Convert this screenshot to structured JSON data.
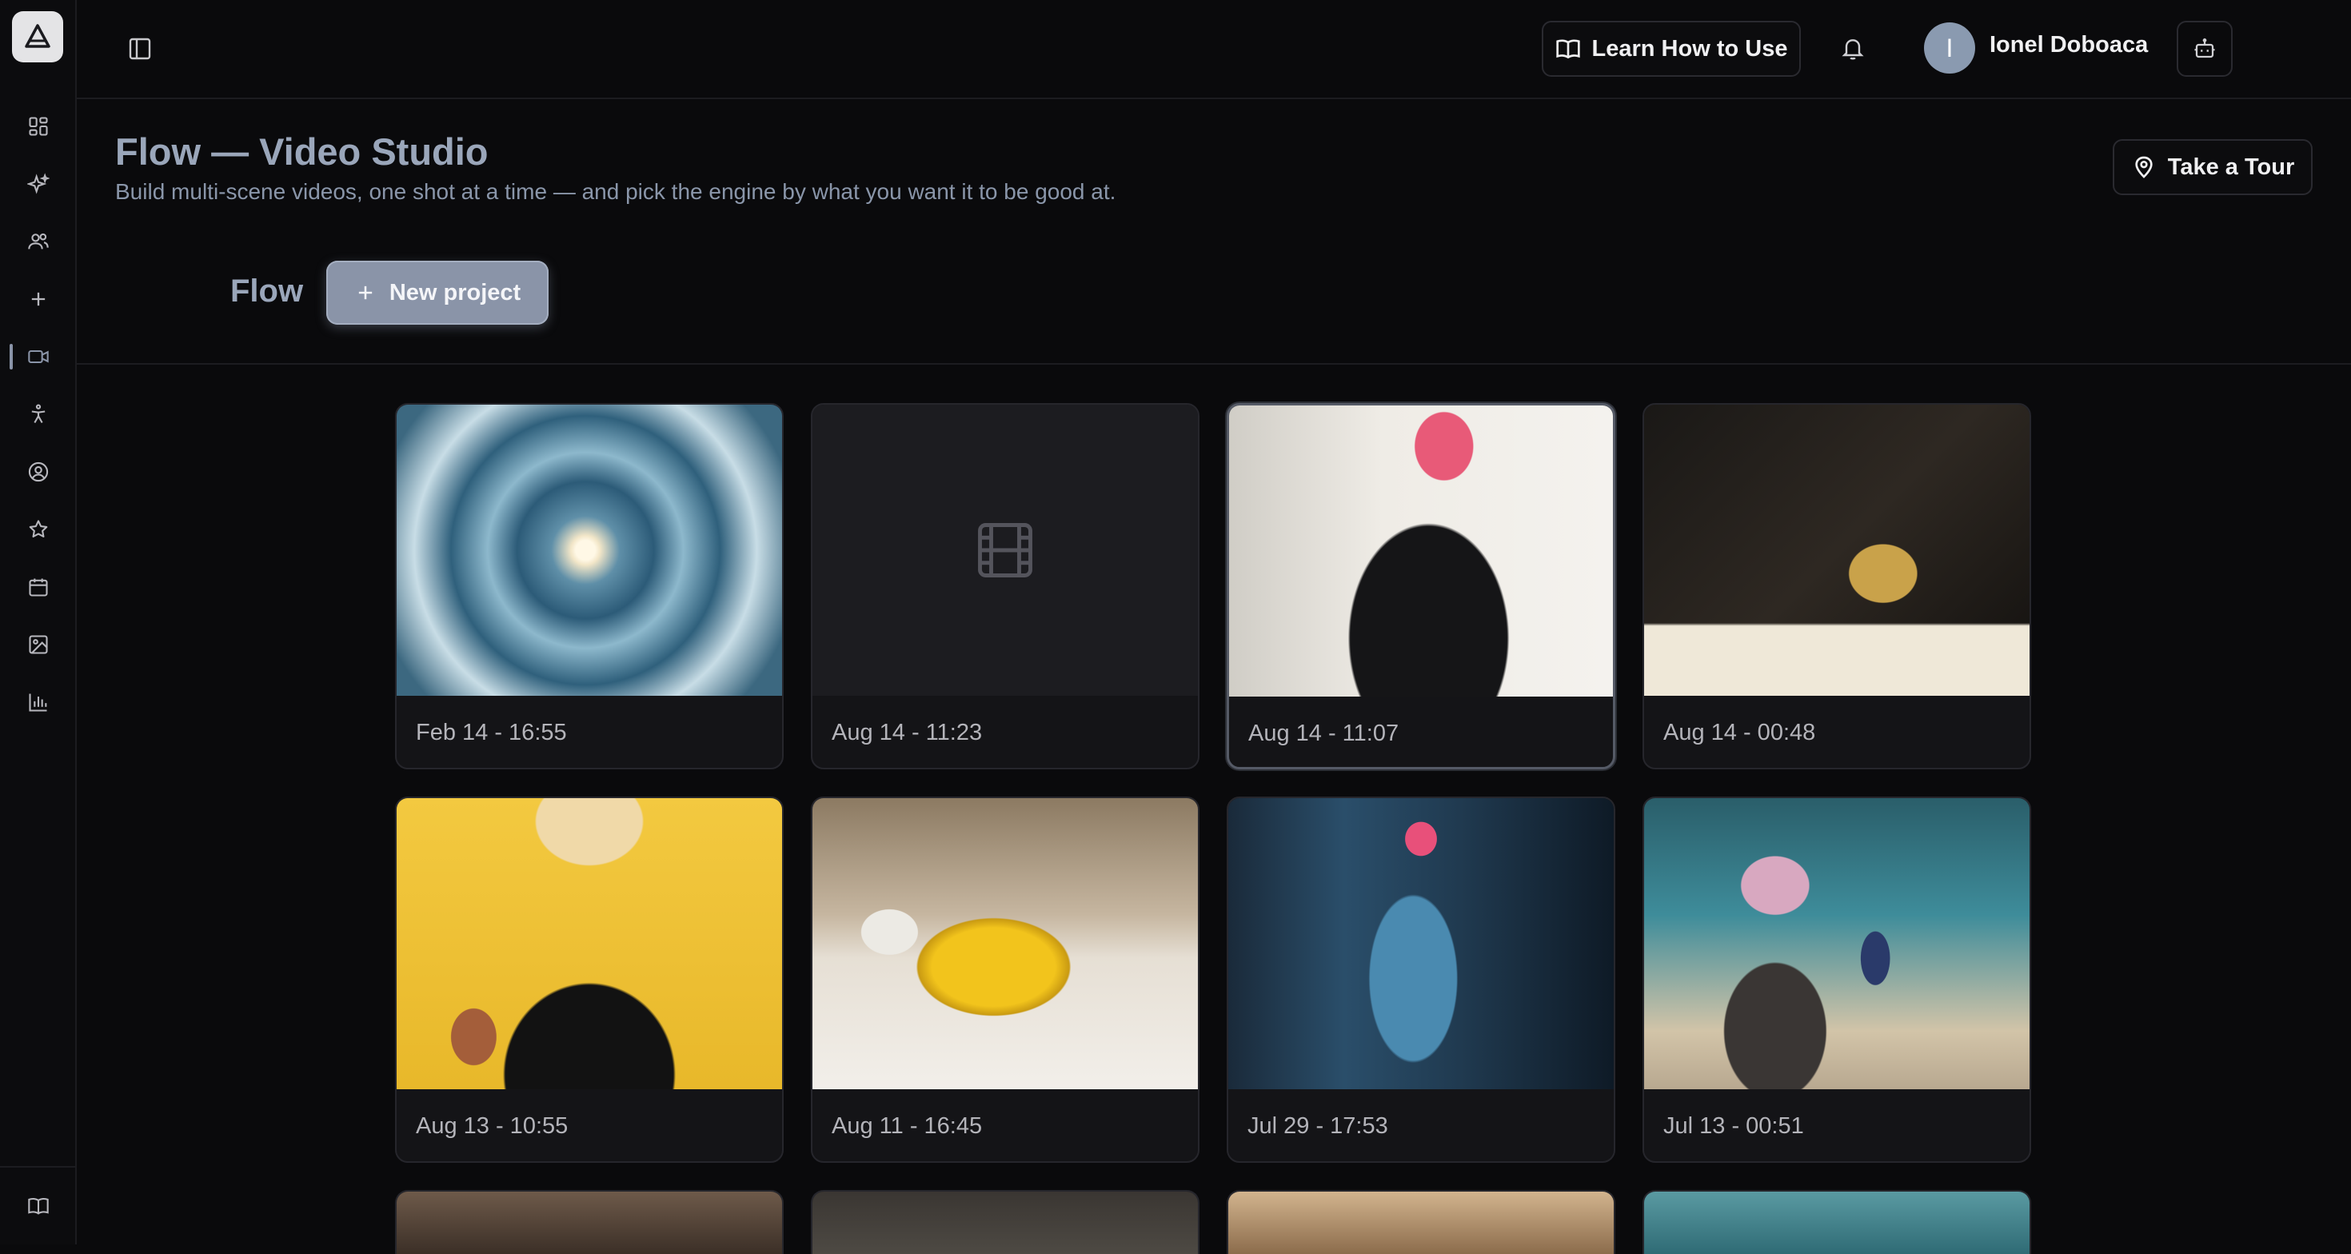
{
  "topbar": {
    "learn_label": "Learn How to Use",
    "avatar_initial": "I",
    "username": "Ionel Doboaca"
  },
  "page": {
    "title": "Flow — Video Studio",
    "subtitle": "Build multi-scene videos, one shot at a time — and pick the engine by what you want it to be good at.",
    "tour_label": "Take a Tour"
  },
  "toolbar": {
    "flow_label": "Flow",
    "new_project_label": "New project"
  },
  "sidebar": {
    "items": [
      {
        "icon": "dashboard-icon"
      },
      {
        "icon": "sparkle-icon"
      },
      {
        "icon": "users-icon"
      },
      {
        "icon": "plus-icon"
      },
      {
        "icon": "video-icon",
        "active": true
      },
      {
        "icon": "accessibility-icon"
      },
      {
        "icon": "user-circle-icon"
      },
      {
        "icon": "star-icon"
      },
      {
        "icon": "calendar-icon"
      },
      {
        "icon": "image-icon"
      },
      {
        "icon": "bar-chart-icon"
      }
    ],
    "bottom_icon": "book-icon"
  },
  "projects": [
    {
      "date": "Feb 14 - 16:55"
    },
    {
      "date": "Aug 14 - 11:23"
    },
    {
      "date": "Aug 14 - 11:07",
      "selected": true
    },
    {
      "date": "Aug 14 - 00:48"
    },
    {
      "date": "Aug 13 - 10:55"
    },
    {
      "date": "Aug 11 - 16:45"
    },
    {
      "date": "Jul 29 - 17:53"
    },
    {
      "date": "Jul 13 - 00:51"
    }
  ],
  "colors": {
    "accent": "#8a94a8",
    "title": "#9aa6ba",
    "background": "#0a0a0c"
  }
}
